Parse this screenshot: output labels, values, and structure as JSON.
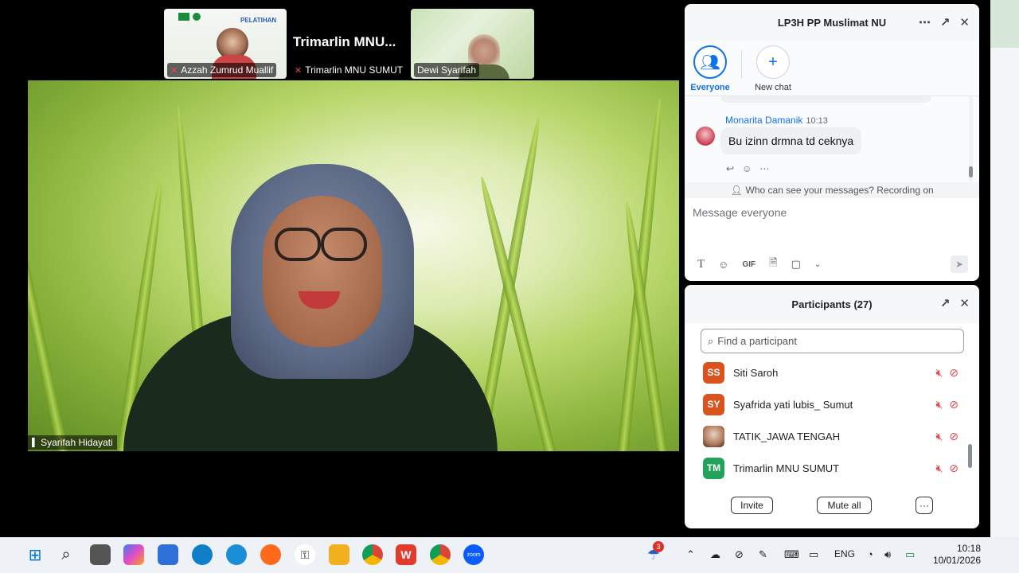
{
  "meeting": {
    "thumbnails": [
      {
        "name": "Azzah Zumrud Muallif",
        "muted": true,
        "banner": "PELATIHAN"
      },
      {
        "name": "Trimarlin MNU SUMUT",
        "muted": true,
        "display_name": "Trimarlin  MNU..."
      },
      {
        "name": "Dewi Syarifah",
        "muted": false
      }
    ],
    "speaker_name": "Syarifah Hidayati"
  },
  "chat": {
    "title": "LP3H PP Muslimat NU",
    "tabs": [
      {
        "label": "Everyone",
        "active": true
      },
      {
        "label": "New chat",
        "active": false
      }
    ],
    "message": {
      "sender": "Monarita Damanik",
      "time": "10:13",
      "text": "Bu izinn drmna td ceknya"
    },
    "visibility_text": "Who can see your messages? Recording on",
    "input_placeholder": "Message everyone",
    "toolbar": {
      "gif": "GIF"
    }
  },
  "participants": {
    "title": "Participants (27)",
    "search_placeholder": "Find a participant",
    "list": [
      {
        "initials": "SS",
        "name": "Siti Saroh",
        "color": "#d9531e"
      },
      {
        "initials": "SY",
        "name": "Syafrida yati lubis_ Sumut",
        "color": "#d9531e"
      },
      {
        "initials": "",
        "name": "TATIK_JAWA TENGAH",
        "color": "#b07a5a",
        "photo": true
      },
      {
        "initials": "TM",
        "name": "Trimarlin MNU SUMUT",
        "color": "#22a35a"
      }
    ],
    "invite_label": "Invite",
    "mute_all_label": "Mute all",
    "more_label": "···"
  },
  "taskbar": {
    "weather_badge": "3",
    "language": "ENG",
    "time": "10:18",
    "date": "10/01/2026"
  },
  "colors": {
    "zoom_blue": "#0e72ed",
    "muted_red": "#e5484d"
  }
}
